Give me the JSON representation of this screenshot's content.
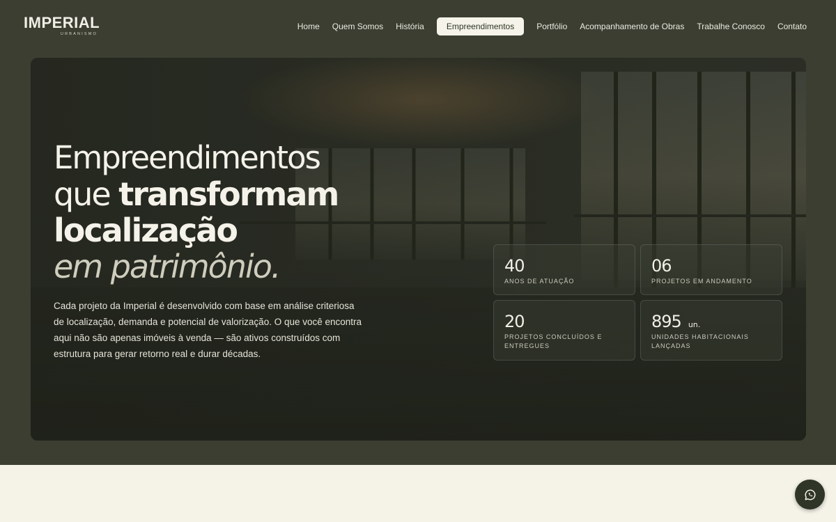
{
  "brand": {
    "name": "IMPERIAL",
    "tagline": "URBANISMO"
  },
  "nav": {
    "items": [
      {
        "label": "Home",
        "active": false
      },
      {
        "label": "Quem Somos",
        "active": false
      },
      {
        "label": "História",
        "active": false
      },
      {
        "label": "Empreendimentos",
        "active": true
      },
      {
        "label": "Portfólio",
        "active": false
      },
      {
        "label": "Acompanhamento de Obras",
        "active": false
      },
      {
        "label": "Trabalhe Conosco",
        "active": false
      },
      {
        "label": "Contato",
        "active": false
      }
    ]
  },
  "hero": {
    "title_line1": "Empreendimentos",
    "title_line2_light": "que ",
    "title_line2_bold": "transformam",
    "title_line3": "localização",
    "title_line4": "em patrimônio.",
    "description": "Cada projeto da Imperial é desenvolvido com base em análise criteriosa de localização, demanda e potencial de valorização. O que você encontra aqui não são apenas imóveis à venda — são ativos construídos com estrutura para gerar retorno real e durar décadas."
  },
  "stats": [
    {
      "value": "40",
      "unit": "",
      "label": "ANOS DE ATUAÇÃO"
    },
    {
      "value": "06",
      "unit": "",
      "label": "PROJETOS EM ANDAMENTO"
    },
    {
      "value": "20",
      "unit": "",
      "label": "PROJETOS CONCLUÍDOS E ENTREGUES"
    },
    {
      "value": "895",
      "unit": "un.",
      "label": "UNIDADES HABITACIONAIS LANÇADAS"
    }
  ],
  "floating": {
    "icon": "whatsapp-icon"
  },
  "colors": {
    "background": "#3b3e31",
    "accent_light": "#f6f4ea",
    "lower_section": "#f5f3e8"
  }
}
